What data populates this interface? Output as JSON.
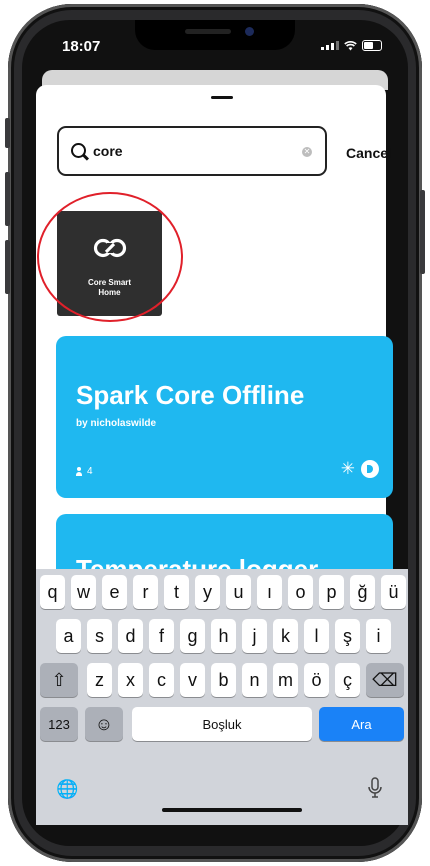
{
  "status_bar": {
    "time": "18:07"
  },
  "search": {
    "query": "core",
    "cancel_label": "Cancel"
  },
  "applet_tile": {
    "name": "Core Smart\nHome",
    "logo": "infinity-link-logo"
  },
  "cards": [
    {
      "title": "Spark Core Offline",
      "author": "by nicholaswilde",
      "users": "4",
      "color": "#1fb8f0",
      "services": [
        "sun-icon",
        "service-logo-icon"
      ]
    },
    {
      "title": "Temperature logger",
      "color": "#1fb8f0"
    }
  ],
  "keyboard": {
    "row1": [
      "q",
      "w",
      "e",
      "r",
      "t",
      "y",
      "u",
      "ı",
      "o",
      "p",
      "ğ",
      "ü"
    ],
    "row2": [
      "a",
      "s",
      "d",
      "f",
      "g",
      "h",
      "j",
      "k",
      "l",
      "ş",
      "i"
    ],
    "row3": [
      "z",
      "x",
      "c",
      "v",
      "b",
      "n",
      "m",
      "ö",
      "ç"
    ],
    "numbers_label": "123",
    "space_label": "Boşluk",
    "return_label": "Ara"
  },
  "colors": {
    "highlight_circle": "#e0202a",
    "card_blue": "#1fb8f0",
    "return_key": "#1a82f7"
  }
}
